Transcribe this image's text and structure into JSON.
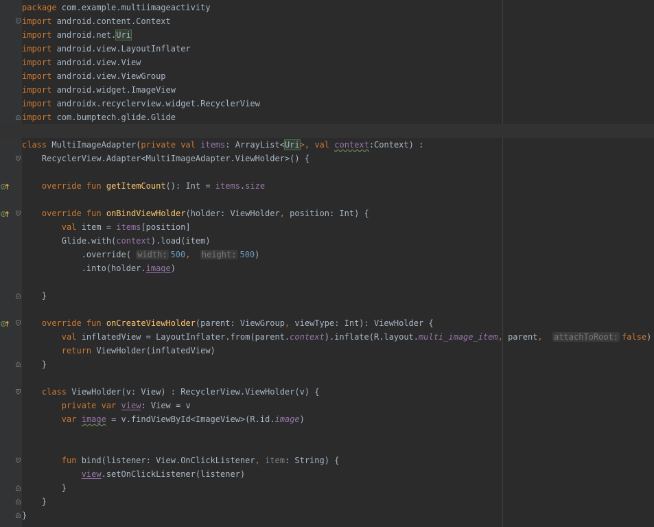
{
  "editor": {
    "language": "kotlin",
    "current_line_index": 9,
    "colors": {
      "background": "#2b2b2b",
      "gutter": "#313335",
      "keyword": "#cc7832",
      "function": "#ffc66d",
      "number": "#6897bb",
      "property": "#9876aa",
      "default": "#a9b7c6",
      "hint": "#787878"
    },
    "code": {
      "l0": [
        "package",
        " com.example.multiimageactivity"
      ],
      "l1": [
        "import",
        " android.content.Context"
      ],
      "l2": [
        "import",
        " android.net.",
        "Uri"
      ],
      "l3": [
        "import",
        " android.view.LayoutInflater"
      ],
      "l4": [
        "import",
        " android.view.View"
      ],
      "l5": [
        "import",
        " android.view.ViewGroup"
      ],
      "l6": [
        "import",
        " android.widget.ImageView"
      ],
      "l7": [
        "import",
        " androidx.recyclerview.widget.RecyclerView"
      ],
      "l8": [
        "import",
        " com.bumptech.glide.Glide"
      ],
      "l10": [
        "class",
        " MultiImageAdapter(",
        "private val",
        " ",
        "items",
        ": ArrayList<",
        "Uri",
        ">, ",
        "val",
        " ",
        "context",
        ":Context) :"
      ],
      "l11": [
        "    RecyclerView.Adapter<MultiImageAdapter.ViewHolder>() {"
      ],
      "l13": [
        "    ",
        "override fun",
        " ",
        "getItemCount",
        "(): Int = ",
        "items",
        ".",
        "size"
      ],
      "l15": [
        "    ",
        "override fun",
        " ",
        "onBindViewHolder",
        "(holder: ViewHolder",
        ", ",
        "position: Int) {"
      ],
      "l16": [
        "        ",
        "val",
        " item = ",
        "items",
        "[position]"
      ],
      "l17": [
        "        Glide.with(",
        "context",
        ").load(item)"
      ],
      "l18": [
        "            .override( ",
        "width:",
        "500",
        ",  ",
        "height:",
        "500",
        ")"
      ],
      "l19": [
        "            .into(holder.",
        "image",
        ")"
      ],
      "l21": [
        "    }"
      ],
      "l23": [
        "    ",
        "override fun",
        " ",
        "onCreateViewHolder",
        "(parent: ViewGroup",
        ", ",
        "viewType: Int): ViewHolder {"
      ],
      "l24": [
        "        ",
        "val",
        " inflatedView = LayoutInflater.from(parent.",
        "context",
        ").inflate(R.layout.",
        "multi_image_item",
        ", ",
        "parent",
        ",  ",
        "attachToRoot:",
        "false",
        ")"
      ],
      "l25": [
        "        ",
        "return",
        " ViewHolder(inflatedView)"
      ],
      "l26": [
        "    }"
      ],
      "l28": [
        "    ",
        "class",
        " ViewHolder(v: View) : RecyclerView.ViewHolder(v) {"
      ],
      "l29": [
        "        ",
        "private var",
        " ",
        "view",
        ": View = v"
      ],
      "l30": [
        "        ",
        "var",
        " ",
        "image",
        " = v.findViewById<ImageView>(R.id.",
        "image",
        ")"
      ],
      "l33": [
        "        ",
        "fun",
        " bind(listener: View.OnClickListener",
        ", ",
        "item",
        ": String) {"
      ],
      "l34": [
        "            ",
        "view",
        ".setOnClickListener(listener)"
      ],
      "l35": [
        "        }"
      ],
      "l36": [
        "    }"
      ],
      "l37": [
        "}"
      ]
    }
  }
}
